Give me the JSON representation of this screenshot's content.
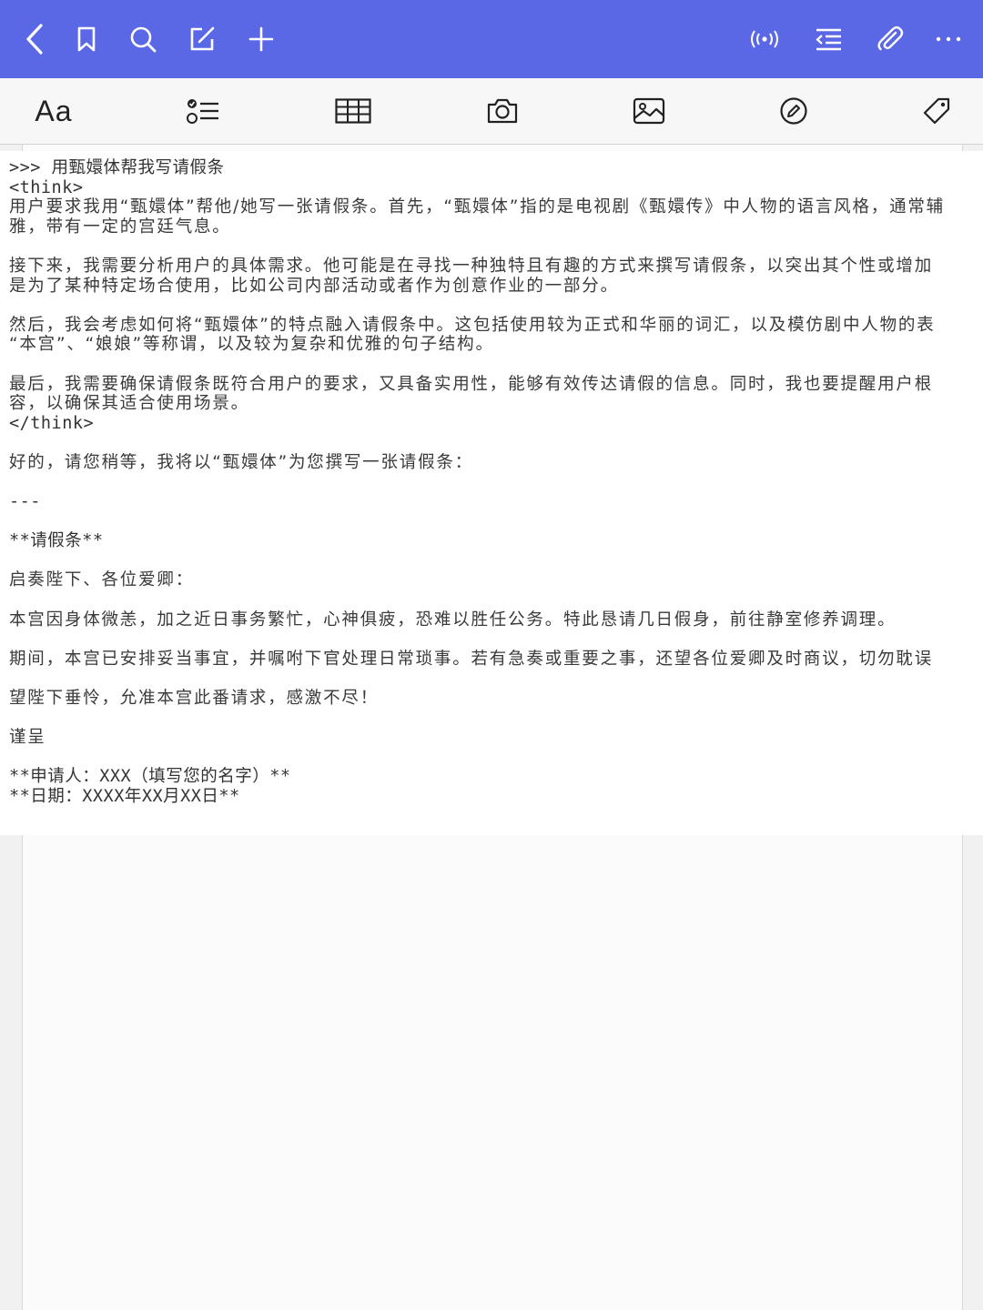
{
  "toolbar_top": {
    "buttons": [
      {
        "name": "back",
        "icon": "chevron-left-icon"
      },
      {
        "name": "bookmark",
        "icon": "bookmark-icon"
      },
      {
        "name": "search",
        "icon": "search-icon"
      },
      {
        "name": "edit",
        "icon": "edit-square-icon"
      },
      {
        "name": "add",
        "icon": "plus-icon"
      },
      {
        "name": "broadcast",
        "icon": "broadcast-icon"
      },
      {
        "name": "outline",
        "icon": "outline-list-icon"
      },
      {
        "name": "attach",
        "icon": "paperclip-icon"
      },
      {
        "name": "more",
        "icon": "more-dots-icon"
      }
    ],
    "color": "#5b68e6"
  },
  "toolbar_format": {
    "font_label": "Aa",
    "buttons": [
      "font-style",
      "checklist",
      "table",
      "camera",
      "image",
      "draw",
      "tag"
    ]
  },
  "document": {
    "lines": [
      ">>> 用甄嬛体帮我写请假条",
      "<think>",
      "用户要求我用“甄嬛体”帮他/她写一张请假条。首先，“甄嬛体”指的是电视剧《甄嬛传》中人物的语言风格，通常辅",
      "雅，带有一定的宫廷气息。",
      "",
      "接下来，我需要分析用户的具体需求。他可能是在寻找一种独特且有趣的方式来撰写请假条，以突出其个性或增加",
      "是为了某种特定场合使用，比如公司内部活动或者作为创意作业的一部分。",
      "",
      "然后，我会考虑如何将“甄嬛体”的特点融入请假条中。这包括使用较为正式和华丽的词汇，以及模仿剧中人物的表",
      "“本宫”、“娘娘”等称谓，以及较为复杂和优雅的句子结构。",
      "",
      "最后，我需要确保请假条既符合用户的要求，又具备实用性，能够有效传达请假的信息。同时，我也要提醒用户根",
      "容，以确保其适合使用场景。",
      "</think>",
      "",
      "好的，请您稍等，我将以“甄嬛体”为您撰写一张请假条：",
      "",
      "---",
      "",
      "**请假条**",
      "",
      "启奏陛下、各位爱卿：",
      "",
      "本宫因身体微恙，加之近日事务繁忙，心神俱疲，恐难以胜任公务。特此恳请几日假身，前往静室修养调理。",
      "",
      "期间，本宫已安排妥当事宜，并嘱咐下官处理日常琐事。若有急奏或重要之事，还望各位爱卿及时商议，切勿耽误",
      "",
      "望陛下垂怜，允准本宫此番请求，感激不尽！",
      "",
      "谨呈",
      "",
      "**申请人：XXX（填写您的名字）**",
      "**日期：XXXX年XX月XX日**",
      "",
      "---"
    ]
  }
}
